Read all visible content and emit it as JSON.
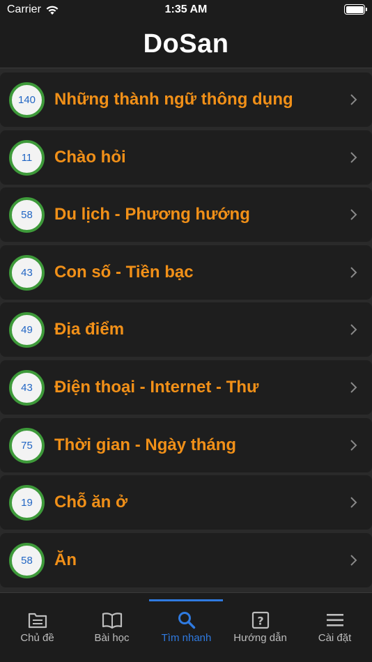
{
  "status_bar": {
    "carrier": "Carrier",
    "time": "1:35 AM"
  },
  "header": {
    "title": "DoSan"
  },
  "topics": [
    {
      "count": "140",
      "label": "Những thành ngữ thông dụng"
    },
    {
      "count": "11",
      "label": "Chào hỏi"
    },
    {
      "count": "58",
      "label": "Du lịch - Phương hướng"
    },
    {
      "count": "43",
      "label": "Con số - Tiền bạc"
    },
    {
      "count": "49",
      "label": "Địa điểm"
    },
    {
      "count": "43",
      "label": "Điện thoại - Internet - Thư"
    },
    {
      "count": "75",
      "label": "Thời gian - Ngày tháng"
    },
    {
      "count": "19",
      "label": "Chỗ ăn ở"
    },
    {
      "count": "58",
      "label": "Ăn"
    }
  ],
  "tab_bar": {
    "tabs": [
      {
        "label": "Chủ đề",
        "icon": "folder-icon"
      },
      {
        "label": "Bài học",
        "icon": "book-icon"
      },
      {
        "label": "Tìm nhanh",
        "icon": "search-icon"
      },
      {
        "label": "Hướng dẫn",
        "icon": "help-icon"
      },
      {
        "label": "Cài đặt",
        "icon": "menu-icon"
      }
    ],
    "active_index": 2
  },
  "colors": {
    "accent": "#2f7ae0",
    "topic_text": "#f19018",
    "badge_ring": "#3e9a3a",
    "badge_number": "#2266c4"
  }
}
